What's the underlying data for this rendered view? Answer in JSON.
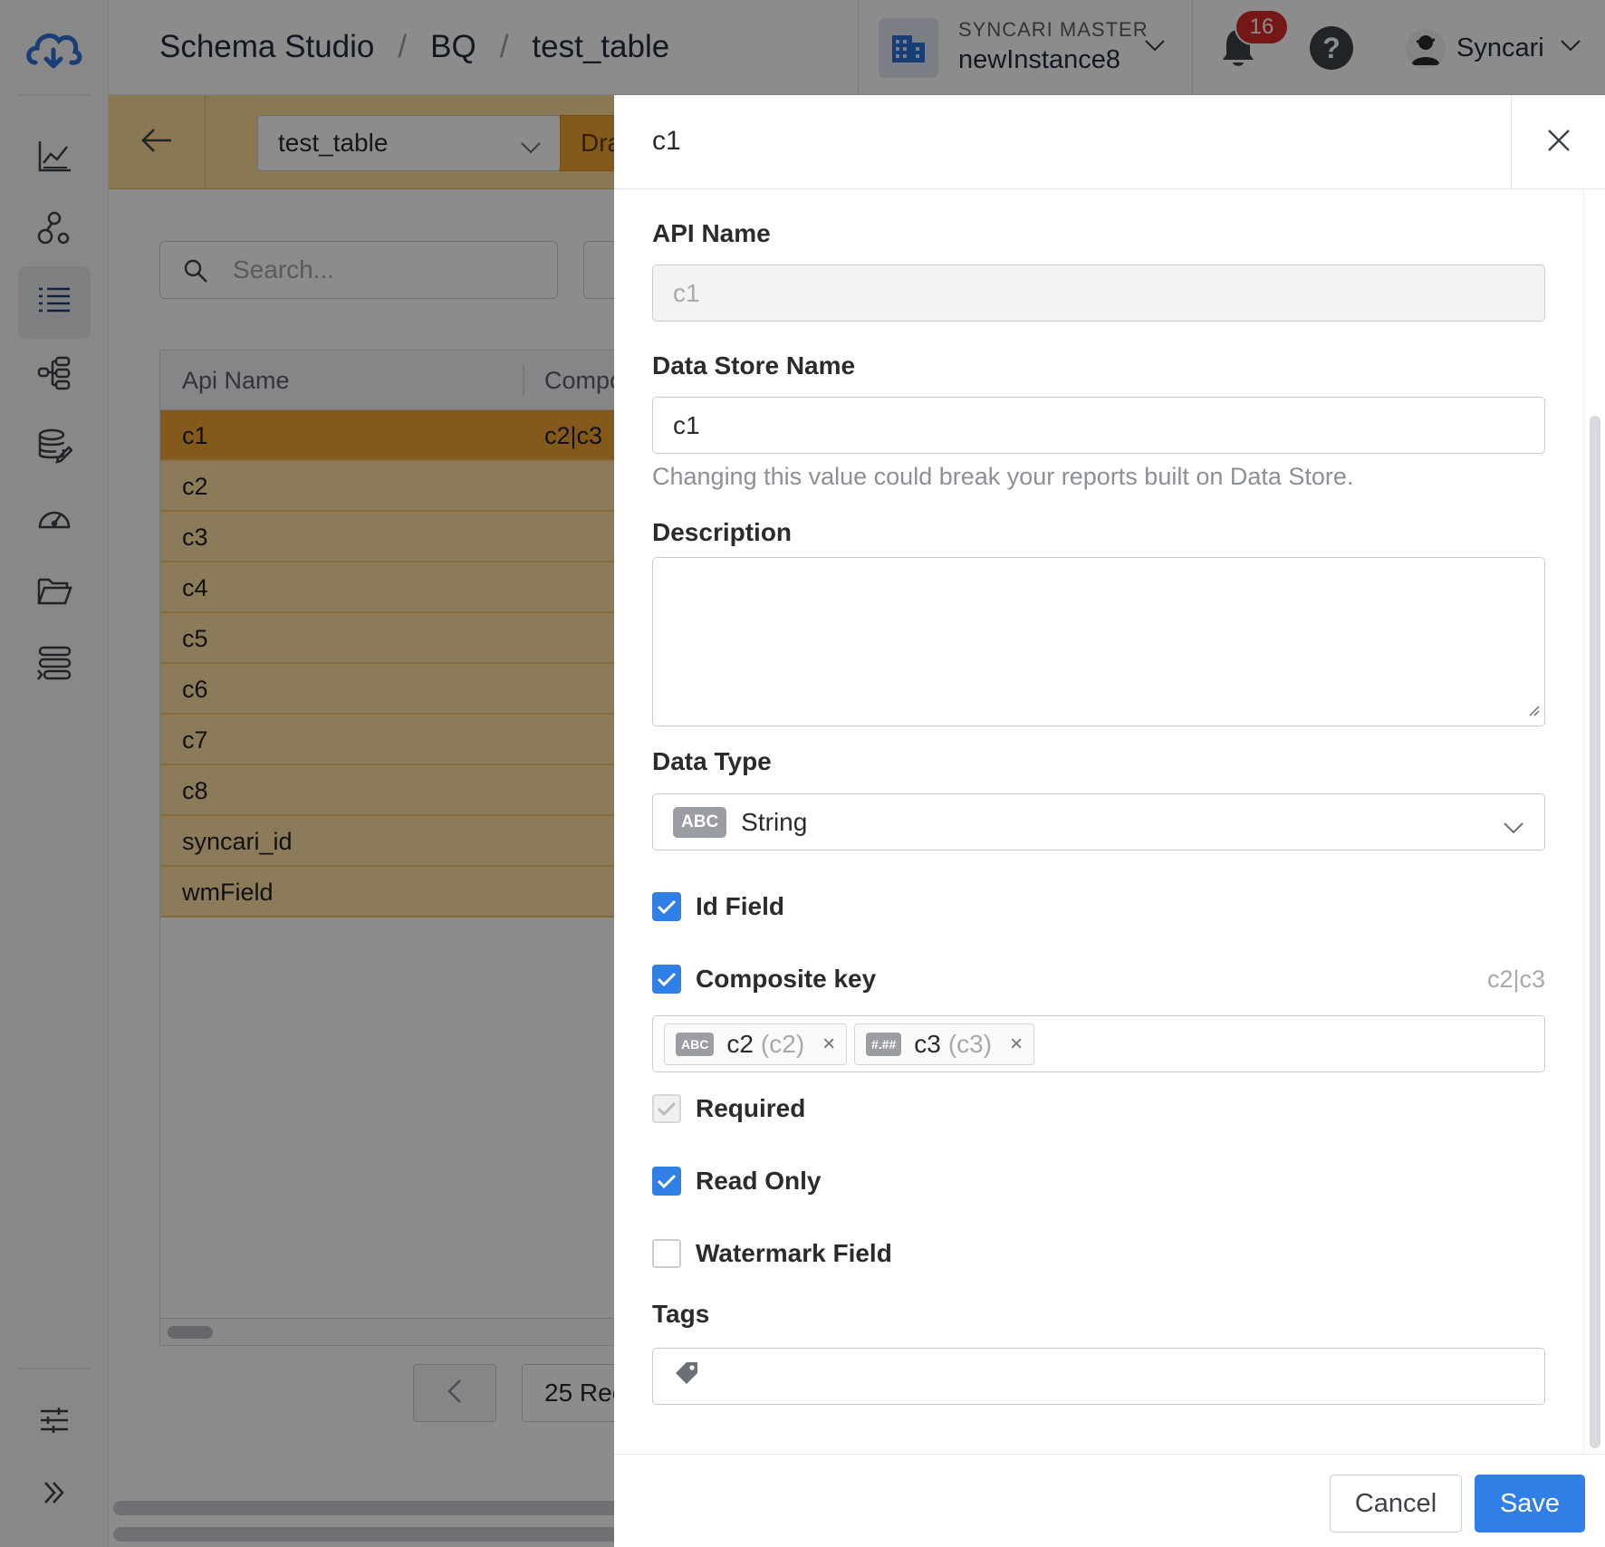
{
  "app": {
    "accent": "#2f7fe6",
    "highlight": "#f0a533"
  },
  "breadcrumb": [
    "Schema Studio",
    "BQ",
    "test_table"
  ],
  "instance": {
    "label": "SYNCARI MASTER",
    "name": "newInstance8"
  },
  "notifications": {
    "count": "16"
  },
  "help": {
    "label": "?"
  },
  "user": {
    "name": "Syncari"
  },
  "sidebar": {
    "items": [
      "dashboard-icon",
      "entities-icon",
      "schema-icon",
      "pipelines-icon",
      "datastore-icon",
      "performance-icon",
      "folder-icon",
      "functions-icon",
      "settings-icon",
      "expand-icon"
    ],
    "active": "schema-icon"
  },
  "subbar": {
    "table_select": "test_table",
    "draft_button": "Dra"
  },
  "list": {
    "search_placeholder": "Search...",
    "columns": [
      "Api Name",
      "Compo"
    ],
    "rows": [
      {
        "api_name": "c1",
        "composite": "c2|c3"
      },
      {
        "api_name": "c2",
        "composite": ""
      },
      {
        "api_name": "c3",
        "composite": ""
      },
      {
        "api_name": "c4",
        "composite": ""
      },
      {
        "api_name": "c5",
        "composite": ""
      },
      {
        "api_name": "c6",
        "composite": ""
      },
      {
        "api_name": "c7",
        "composite": ""
      },
      {
        "api_name": "c8",
        "composite": ""
      },
      {
        "api_name": "syncari_id",
        "composite": ""
      },
      {
        "api_name": "wmField",
        "composite": ""
      }
    ],
    "page_size": "25 Rec"
  },
  "drawer": {
    "title": "c1",
    "api_name": {
      "label": "API Name",
      "value": "c1"
    },
    "data_store_name": {
      "label": "Data Store Name",
      "value": "c1",
      "hint": "Changing this value could break your reports built on Data Store."
    },
    "description": {
      "label": "Description",
      "value": ""
    },
    "data_type": {
      "label": "Data Type",
      "badge": "ABC",
      "value": "String"
    },
    "id_field": {
      "label": "Id Field",
      "checked": true
    },
    "composite_key": {
      "label": "Composite key",
      "checked": true,
      "value": "c2|c3",
      "chips": [
        {
          "badge": "ABC",
          "name": "c2",
          "sub": "(c2)",
          "remove": "×"
        },
        {
          "badge": "#.##",
          "name": "c3",
          "sub": "(c3)",
          "remove": "×"
        }
      ]
    },
    "required": {
      "label": "Required",
      "checked": true,
      "disabled": true
    },
    "read_only": {
      "label": "Read Only",
      "checked": true
    },
    "watermark": {
      "label": "Watermark Field",
      "checked": false
    },
    "tags": {
      "label": "Tags"
    },
    "cancel_label": "Cancel",
    "save_label": "Save"
  }
}
